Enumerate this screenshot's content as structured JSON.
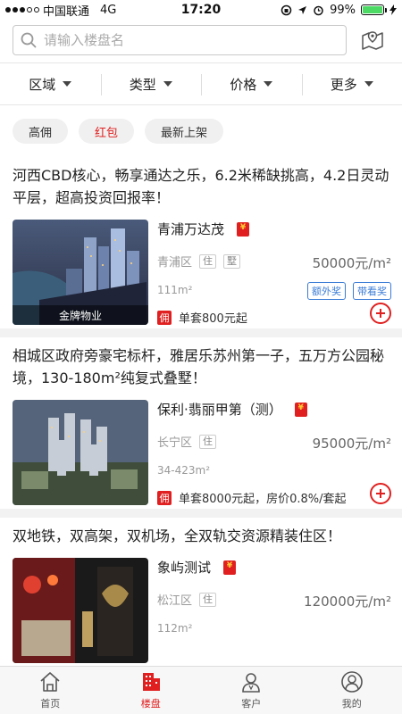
{
  "status_bar": {
    "carrier": "中国联通",
    "network": "4G",
    "time": "17:20",
    "battery": "99%",
    "battery_level": 0.99
  },
  "search": {
    "placeholder": "请输入楼盘名",
    "map_icon": "map-pin-icon"
  },
  "filters": [
    {
      "label": "区域"
    },
    {
      "label": "类型"
    },
    {
      "label": "价格"
    },
    {
      "label": "更多"
    }
  ],
  "tags": [
    {
      "label": "高佣"
    },
    {
      "label": "红包"
    },
    {
      "label": "最新上架"
    }
  ],
  "listings": [
    {
      "title": "河西CBD核心，畅享通达之乐，6.2米稀缺挑高，4.2日灵动平层，超高投资回报率！",
      "name": "青浦万达茂",
      "district": "青浦区",
      "tag1": "住",
      "tag2": "墅",
      "price": "50000元/m²",
      "size": "111m²",
      "caption": "金牌物业",
      "badge1": "额外奖",
      "badge2": "带看奖",
      "yong": "佣",
      "commission": "单套800元起"
    },
    {
      "title": "相城区政府旁豪宅标杆，雅居乐苏州第一子，五万方公园秘境，130-180m²纯复式叠墅！",
      "name": "保利·翡丽甲第（测）",
      "district": "长宁区",
      "tag1": "住",
      "price": "95000元/m²",
      "size": "34-423m²",
      "yong": "佣",
      "commission": "单套8000元起，房价0.8%/套起"
    },
    {
      "title": "双地铁，双高架，双机场，全双轨交资源精装住区！",
      "name": "象屿测试",
      "district": "松江区",
      "tag1": "住",
      "price": "120000元/m²",
      "size": "112m²"
    }
  ],
  "tab_bar": [
    {
      "label": "首页",
      "icon": "home-icon"
    },
    {
      "label": "楼盘",
      "icon": "building-icon"
    },
    {
      "label": "客户",
      "icon": "customer-icon"
    },
    {
      "label": "我的",
      "icon": "profile-icon"
    }
  ],
  "colors": {
    "accent": "#e02020",
    "badge_blue": "#3a7bd5"
  }
}
